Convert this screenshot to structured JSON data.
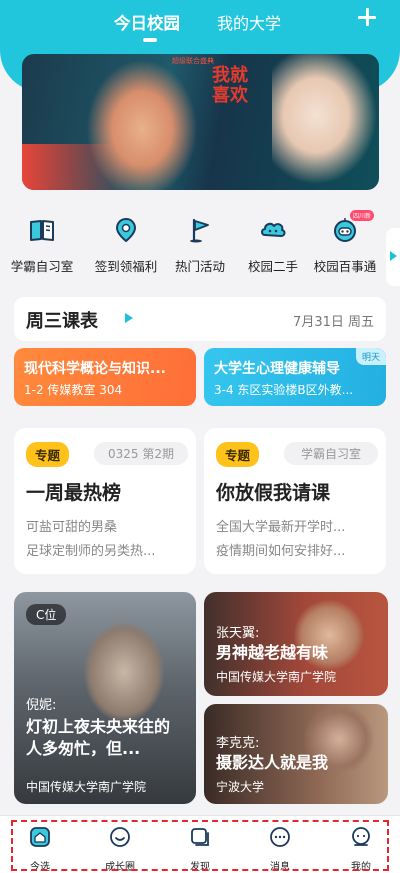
{
  "header": {
    "tabs": [
      {
        "label": "今日校园",
        "active": true
      },
      {
        "label": "我的大学",
        "active": false
      }
    ],
    "accent_color": "#22c6dc"
  },
  "banner": {
    "headline": "我就喜欢",
    "subtext": "超级联合盛典"
  },
  "quick_links": [
    {
      "label": "学霸自习室",
      "icon": "book-icon"
    },
    {
      "label": "签到领福利",
      "icon": "location-pin-icon"
    },
    {
      "label": "热门活动",
      "icon": "flag-icon"
    },
    {
      "label": "校园二手",
      "icon": "cloud-icon"
    },
    {
      "label": "校园百事通",
      "icon": "robot-icon",
      "badge": "四川新"
    }
  ],
  "schedule": {
    "title": "周三课表",
    "date": "7月31日 周五",
    "courses": [
      {
        "name": "现代科学概论与知识...",
        "detail": "1-2 传媒教室 304"
      },
      {
        "name": "大学生心理健康辅导",
        "detail": "3-4 东区实验楼B区外教...",
        "tag": "明天"
      }
    ]
  },
  "topics": [
    {
      "tag": "专题",
      "meta": "0325 第2期",
      "title": "一周最热榜",
      "lines": [
        "可盐可甜的男桑",
        "足球定制师的另类热..."
      ]
    },
    {
      "tag": "专题",
      "meta": "学霸自习室",
      "title": "你放假我请课",
      "lines": [
        "全国大学最新开学时...",
        "疫情期间如何安排好..."
      ]
    }
  ],
  "feature_cards": [
    {
      "badge": "C位",
      "author": "倪妮:",
      "title": "灯初上夜未央来往的人多匆忙，但...",
      "school": "中国传媒大学南广学院"
    },
    {
      "author": "张天翼:",
      "title": "男神越老越有味",
      "school": "中国传媒大学南广学院"
    },
    {
      "author": "李克克:",
      "title": "摄影达人就是我",
      "school": "宁波大学"
    }
  ],
  "bottom_nav": [
    {
      "label": "今选",
      "icon": "home-icon",
      "active": true
    },
    {
      "label": "成长圈",
      "icon": "smile-icon"
    },
    {
      "label": "发现",
      "icon": "discover-icon"
    },
    {
      "label": "消息",
      "icon": "message-icon"
    },
    {
      "label": "我的",
      "icon": "profile-icon"
    }
  ]
}
